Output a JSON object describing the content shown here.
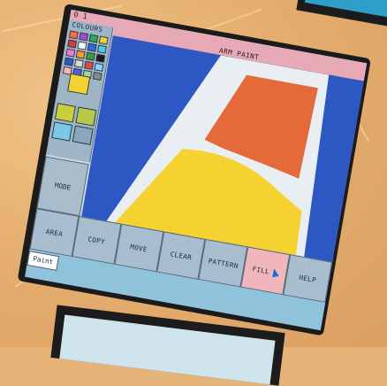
{
  "app": {
    "window_title": "ARM PAINT",
    "corner_numbers": "0 1"
  },
  "palette": {
    "title": "COLOURS",
    "swatches": [
      "#ff6a3a",
      "#a34bd1",
      "#2ea84a",
      "#e7d23a",
      "#d83a3a",
      "#ffffff",
      "#3266d6",
      "#51c9e6",
      "#f07ad1",
      "#ff9a2a",
      "#3c9c3c",
      "#1b1b1b",
      "#2d57c2",
      "#d9d9d9",
      "#e04a4a",
      "#8bd0ff",
      "#ffb3b3",
      "#5a5ad6",
      "#9fd39f",
      "#888888"
    ],
    "current_colour": "#f2d233",
    "patterns": [
      "#c9cf3b",
      "#b7c94a",
      "#7cc7e6",
      "#8aa5bd"
    ]
  },
  "mode": {
    "label": "MODE"
  },
  "canvas": {
    "background": "#2d57c2",
    "shapes": {
      "white_wedge": "#e9eef2",
      "orange_region": "#e46a3a",
      "yellow_region": "#f5d22f"
    }
  },
  "toolbar": {
    "area": "AREA",
    "copy": "COPY",
    "move": "MOVE",
    "clear": "CLEAR",
    "pattern": "PATTERN",
    "fill": "FILL",
    "help": "HELP"
  },
  "status": {
    "tab": "Paint"
  }
}
